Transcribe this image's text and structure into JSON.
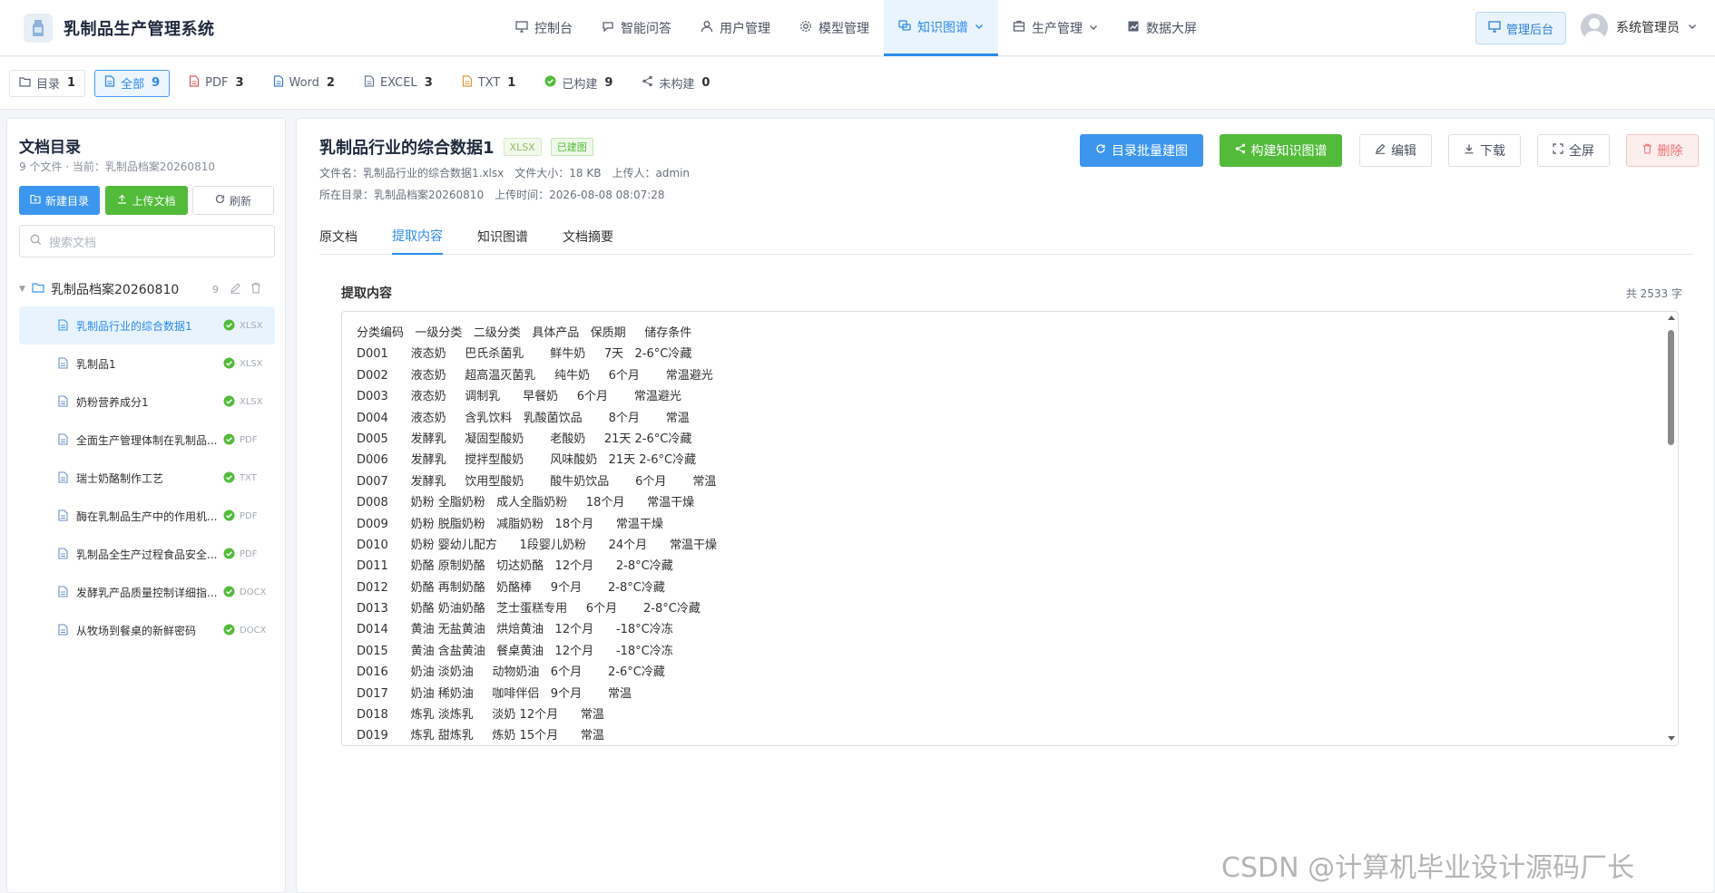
{
  "header": {
    "app_title": "乳制品生产管理系统",
    "nav": [
      {
        "label": "控制台",
        "icon": "monitor-icon"
      },
      {
        "label": "智能问答",
        "icon": "chat-icon"
      },
      {
        "label": "用户管理",
        "icon": "user-icon"
      },
      {
        "label": "模型管理",
        "icon": "gear-icon"
      },
      {
        "label": "知识图谱",
        "icon": "graph-icon",
        "active": true,
        "dropdown": true
      },
      {
        "label": "生产管理",
        "icon": "factory-icon",
        "dropdown": true
      },
      {
        "label": "数据大屏",
        "icon": "chart-icon"
      }
    ],
    "admin_button": "管理后台",
    "user_name": "系统管理员"
  },
  "filters": [
    {
      "label": "目录",
      "count": "1",
      "icon": "folder-icon"
    },
    {
      "label": "全部",
      "count": "9",
      "icon": "doc-icon",
      "active": true
    },
    {
      "label": "PDF",
      "count": "3",
      "icon": "pdf-icon"
    },
    {
      "label": "Word",
      "count": "2",
      "icon": "word-icon"
    },
    {
      "label": "EXCEL",
      "count": "3",
      "icon": "excel-icon"
    },
    {
      "label": "TXT",
      "count": "1",
      "icon": "txt-icon"
    },
    {
      "label": "已构建",
      "count": "9",
      "icon": "check-icon"
    },
    {
      "label": "未构建",
      "count": "0",
      "icon": "share-icon"
    }
  ],
  "sidebar": {
    "title": "文档目录",
    "subtitle": "9 个文件 · 当前：乳制品档案20260810",
    "new_folder": "新建目录",
    "upload": "上传文档",
    "refresh": "刷新",
    "search_placeholder": "搜索文档",
    "folder": {
      "name": "乳制品档案20260810",
      "count": "9"
    },
    "files": [
      {
        "name": "乳制品行业的综合数据1",
        "type": "XLSX",
        "active": true
      },
      {
        "name": "乳制品1",
        "type": "XLSX"
      },
      {
        "name": "奶粉营养成分1",
        "type": "XLSX"
      },
      {
        "name": "全面生产管理体制在乳制品...",
        "type": "PDF"
      },
      {
        "name": "瑞士奶酪制作工艺",
        "type": "TXT"
      },
      {
        "name": "酶在乳制品生产中的作用机...",
        "type": "PDF"
      },
      {
        "name": "乳制品全生产过程食品安全...",
        "type": "PDF"
      },
      {
        "name": "发酵乳产品质量控制详细指...",
        "type": "DOCX"
      },
      {
        "name": "从牧场到餐桌的新鲜密码",
        "type": "DOCX"
      }
    ]
  },
  "document": {
    "title": "乳制品行业的综合数据1",
    "type_tag": "XLSX",
    "status_tag": "已建图",
    "file_name": "文件名：乳制品行业的综合数据1.xlsx",
    "file_size": "文件大小：18 KB",
    "uploader": "上传人：admin",
    "directory": "所在目录：乳制品档案20260810",
    "upload_time": "上传时间：2026-08-08 08:07:28",
    "actions": {
      "batch": "目录批量建图",
      "build": "构建知识图谱",
      "edit": "编辑",
      "download": "下载",
      "fullscreen": "全屏",
      "delete": "删除"
    },
    "tabs": [
      "原文档",
      "提取内容",
      "知识图谱",
      "文档摘要"
    ],
    "active_tab": "提取内容",
    "extract_title": "提取内容",
    "char_count": "共 2533 字",
    "lines": [
      "分类编码   一级分类   二级分类   具体产品   保质期     储存条件",
      "D001      液态奶     巴氏杀菌乳       鲜牛奶     7天   2-6°C冷藏",
      "D002      液态奶     超高温灭菌乳     纯牛奶     6个月       常温避光",
      "D003      液态奶     调制乳      早餐奶     6个月       常温避光",
      "D004      液态奶     含乳饮料   乳酸菌饮品       8个月       常温",
      "D005      发酵乳     凝固型酸奶       老酸奶     21天 2-6°C冷藏",
      "D006      发酵乳     搅拌型酸奶       风味酸奶   21天 2-6°C冷藏",
      "D007      发酵乳     饮用型酸奶       酸牛奶饮品       6个月       常温",
      "D008      奶粉 全脂奶粉   成人全脂奶粉     18个月      常温干燥",
      "D009      奶粉 脱脂奶粉   减脂奶粉   18个月      常温干燥",
      "D010      奶粉 婴幼儿配方      1段婴儿奶粉      24个月      常温干燥",
      "D011      奶酪 原制奶酪   切达奶酪   12个月      2-8°C冷藏",
      "D012      奶酪 再制奶酪   奶酪棒     9个月       2-8°C冷藏",
      "D013      奶酪 奶油奶酪   芝士蛋糕专用     6个月       2-8°C冷藏",
      "D014      黄油 无盐黄油   烘焙黄油   12个月      -18°C冷冻",
      "D015      黄油 含盐黄油   餐桌黄油   12个月      -18°C冷冻",
      "D016      奶油 淡奶油     动物奶油   6个月       2-6°C冷藏",
      "D017      奶油 稀奶油     咖啡伴侣   9个月       常温",
      "D018      炼乳 淡炼乳     淡奶 12个月      常温",
      "D019      炼乳 甜炼乳     炼奶 15个月      常温"
    ]
  },
  "watermark": "CSDN @计算机毕业设计源码厂长"
}
